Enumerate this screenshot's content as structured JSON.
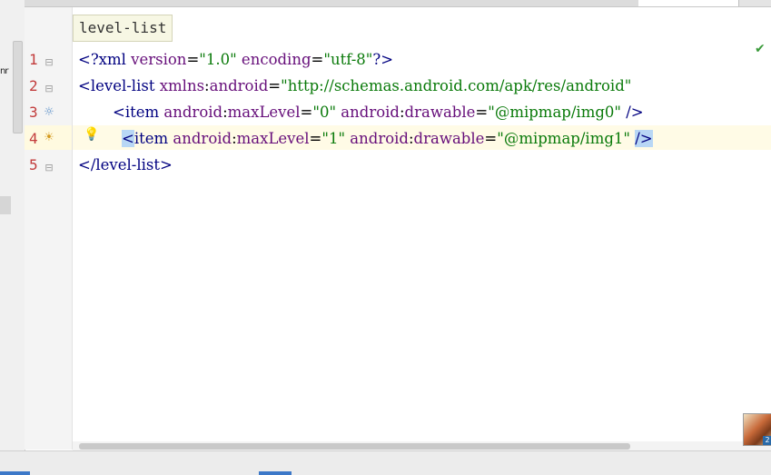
{
  "tooltip": {
    "text": "level-list"
  },
  "sidebar": {
    "fragment_text": "nr"
  },
  "editor": {
    "lines": [
      {
        "num": "1",
        "parts": {
          "open": "<?",
          "tag": "xml",
          "a1": " version",
          "eq1": "=",
          "v1": "\"1.0\"",
          "a2": " encoding",
          "eq2": "=",
          "v2": "\"utf-8\"",
          "close": "?>"
        }
      },
      {
        "num": "2",
        "parts": {
          "open": "<",
          "tag": "level-list",
          "a1": " xmlns",
          "colon": ":",
          "a1b": "android",
          "eq1": "=",
          "v1": "\"http://schemas.android.com/apk/res/android\""
        }
      },
      {
        "num": "3",
        "parts": {
          "open": "<",
          "tag": "item",
          "a1": " android",
          "colon1": ":",
          "a1b": "maxLevel",
          "eq1": "=",
          "v1": "\"0\"",
          "a2": " android",
          "colon2": ":",
          "a2b": "drawable",
          "eq2": "=",
          "v2": "\"@mipmap/img0\"",
          "close": " />"
        }
      },
      {
        "num": "4",
        "parts": {
          "open": "<",
          "tag": "item",
          "a1": " android",
          "colon1": ":",
          "a1b": "maxLevel",
          "eq1": "=",
          "v1": "\"1\"",
          "a2": " android",
          "colon2": ":",
          "a2b": "drawable",
          "eq2": "=",
          "v2": "\"@mipmap/img1\"",
          "close": "/>"
        }
      },
      {
        "num": "5",
        "parts": {
          "open": "</",
          "tag": "level-list",
          "close": ">"
        }
      }
    ]
  },
  "icons": {
    "line3_gutter": "sun-icon",
    "line4_gutter": "sun-cloud-icon",
    "intention": "lightbulb-icon",
    "status_ok": "check-icon",
    "fold2": "fold-minus-icon",
    "fold5": "fold-end-icon"
  },
  "colors": {
    "tag": "#000080",
    "attribute": "#660e7a",
    "value": "#0a7a0a",
    "line_number": "#c23b3b",
    "caret_row": "#fffbe6",
    "brace_match": "#b8d7f5"
  }
}
